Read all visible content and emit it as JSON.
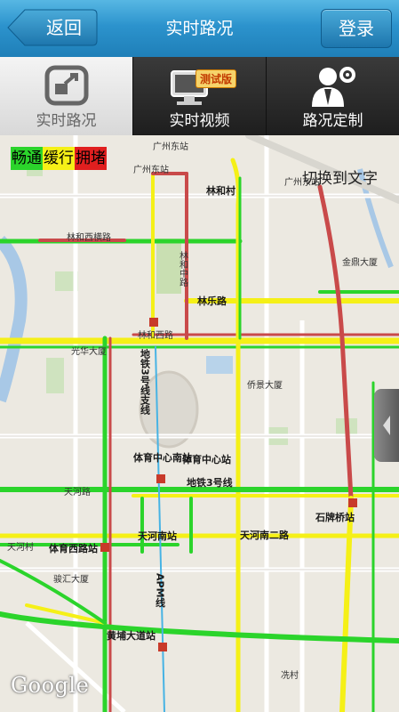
{
  "header": {
    "back_label": "返回",
    "title": "实时路况",
    "login_label": "登录"
  },
  "tabs": [
    {
      "label": "实时路况",
      "icon": "zoom-map-icon",
      "active": true
    },
    {
      "label": "实时视频",
      "icon": "monitor-icon",
      "badge": "测试版"
    },
    {
      "label": "路况定制",
      "icon": "user-gear-icon"
    }
  ],
  "legend": [
    {
      "label": "畅通",
      "color": "#2bd42b"
    },
    {
      "label": "缓行",
      "color": "#f5f017"
    },
    {
      "label": "拥堵",
      "color": "#e01f1f"
    }
  ],
  "map": {
    "toggle_text": "切换到文字",
    "attribution": "Google",
    "labels": {
      "guangzhou_east_1": "广州东站",
      "guangzhou_east_2": "广州东站",
      "guangzhou_east_3": "广州东站",
      "linhe_village": "林和村",
      "linhe_west_heng": "林和西横路",
      "linhe_middle": "林和中路",
      "linle_road": "林乐路",
      "jinding": "金鼎大厦",
      "guanghua": "光华大厦",
      "linhe_west": "林和西路",
      "qiaoyi": "侨景大厦",
      "metro3": "地铁3号线支线",
      "sports_center_south": "体育中心南站",
      "sports_center": "体育中心站",
      "tianhe_road": "天河路",
      "metro3b": "地铁3号线",
      "shipai_bridge": "石牌桥站",
      "tianhe_village": "天河村",
      "sports_west": "体育西路站",
      "tianhe_south": "天河南站",
      "tianhe_south2": "天河南二路",
      "junhui": "骏汇大厦",
      "apm": "APM线",
      "huangpu": "黄埔大道站",
      "xiancun": "冼村"
    }
  }
}
